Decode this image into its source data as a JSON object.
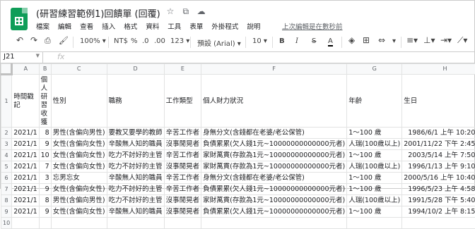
{
  "doc": {
    "title": "(研習練習範例1)回饋單 (回覆)",
    "star_icon": "star-icon",
    "move_icon": "folder-move-icon",
    "cloud_icon": "cloud-status-icon"
  },
  "menu": [
    "檔案",
    "編輯",
    "查看",
    "插入",
    "格式",
    "資料",
    "工具",
    "表單",
    "外掛程式",
    "說明"
  ],
  "last_edit": "上次編輯是在數秒前",
  "toolbar": {
    "zoom": "100%",
    "currency": "NT$",
    "percent": "%",
    "dec_decrease": ".0",
    "dec_increase": ".00",
    "more_formats": "123",
    "font": "預設 (Arial)",
    "font_size": "10",
    "bold": "B",
    "italic": "I",
    "strike": "S",
    "text_color": "A"
  },
  "name_box": "J21",
  "fx": "fx",
  "sheet": {
    "col_letters": [
      "A",
      "B",
      "C",
      "D",
      "E",
      "F",
      "G",
      "H"
    ],
    "headers": [
      "時間戳記",
      "個人研習收獲",
      "性別",
      "職務",
      "工作類型",
      "個人財力狀況",
      "年齡",
      "生日"
    ],
    "rows": [
      [
        "2021/1",
        "8",
        "男性(含偏向男性)",
        "要教又要學的教師",
        "辛苦工作者",
        "身無分文(含錢都在老婆/老公保管)",
        "1～100 歲",
        "1986/6/1 上午 10:20:00"
      ],
      [
        "2021/1",
        "9",
        "女性(含偏向女性)",
        "辛酸無人知的職員",
        "沒事閒晃者",
        "負債累累(欠人錢1元~10000000000000元者)",
        "人瑞(100歲以上)",
        "2001/11/22 下午 2:45:00"
      ],
      [
        "2021/1",
        "10",
        "女性(含偏向女性)",
        "吃力不討好的主管",
        "辛苦工作者",
        "家財萬貫(存款為1元~10000000000000元者)",
        "1～100 歲",
        "2003/5/14 上午 7:50:00"
      ],
      [
        "2021/1",
        "7",
        "女性(含偏向女性)",
        "吃力不討好的主管",
        "沒事閒晃者",
        "家財萬貫(存款為1元~10000000000000元者)",
        "人瑞(100歲以上)",
        "1996/1/13 上午 9:10:00"
      ],
      [
        "2021/1",
        "3",
        "忘男忘女",
        "辛酸無人知的職員",
        "辛苦工作者",
        "身無分文(含錢都在老婆/老公保管)",
        "1～100 歲",
        "2000/5/16 上午 10:40:00"
      ],
      [
        "2021/1",
        "9",
        "女性(含偏向女性)",
        "吃力不討好的主管",
        "辛苦工作者",
        "負債累累(欠人錢1元~10000000000000元者)",
        "1～100 歲",
        "1996/5/23 上午 4:58:00"
      ],
      [
        "2021/1",
        "8",
        "男性(含偏向男性)",
        "吃力不討好的主管",
        "沒事閒晃者",
        "家財萬貫(存款為1元~10000000000000元者)",
        "人瑞(100歲以上)",
        "1991/5/28 下午 5:40:00"
      ],
      [
        "2021/1",
        "9",
        "女性(含偏向女性)",
        "辛酸無人知的職員",
        "沒事閒晃者",
        "負債累累(欠人錢1元~10000000000000元者)",
        "1～100 歲",
        "1994/10/2 上午 8:15:00"
      ]
    ],
    "last_row_number": "10"
  },
  "colors": {
    "brand": "#0f9d58",
    "grid": "#e2e3e3",
    "header_bg": "#f8f9fa"
  }
}
